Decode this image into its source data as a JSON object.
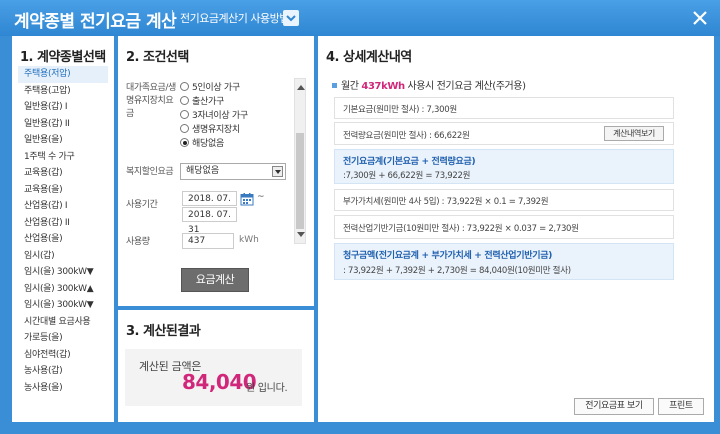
{
  "window": {
    "title": "계약종별 전기요금 계산",
    "guide_link": "전기요금계산기 사용방법"
  },
  "contract_panel": {
    "heading": "1. 계약종별선택",
    "items": [
      {
        "label": "주택용(저압)",
        "selected": true
      },
      {
        "label": "주택용(고압)"
      },
      {
        "label": "일반용(갑) I"
      },
      {
        "label": "일반용(갑) II"
      },
      {
        "label": "일반용(을)"
      },
      {
        "label": "1주택 수 가구"
      },
      {
        "label": "교육용(갑)"
      },
      {
        "label": "교육용(을)"
      },
      {
        "label": "산업용(갑) I"
      },
      {
        "label": "산업용(갑) II"
      },
      {
        "label": "산업용(을)"
      },
      {
        "label": "임시(갑)"
      },
      {
        "label": "임시(을) 300kW▼"
      },
      {
        "label": "임시(을) 300kW▲"
      },
      {
        "label": "임시(을) 300kW▼"
      },
      {
        "label": "시간대별 요금사용"
      },
      {
        "label": "가로등(을)"
      },
      {
        "label": "심야전력(갑)"
      },
      {
        "label": "농사용(갑)"
      },
      {
        "label": "농사용(을)"
      }
    ]
  },
  "condition_panel": {
    "heading": "2. 조건선택",
    "discount_label": "대가족요금/생명유지장치요금",
    "options": [
      {
        "label": "5인이상 가구",
        "checked": false
      },
      {
        "label": "출산가구",
        "checked": false
      },
      {
        "label": "3자녀이상 가구",
        "checked": false
      },
      {
        "label": "생명유지장치",
        "checked": false
      },
      {
        "label": "해당없음",
        "checked": true
      }
    ],
    "welfare_label": "복지할인요금",
    "welfare_value": "해당없음",
    "period_label": "사용기간",
    "period_start": "2018. 07. 01",
    "period_end": "2018. 07. 31",
    "period_sep": "~",
    "usage_label": "사용량",
    "usage_value": "437",
    "usage_unit": "kWh",
    "calc_button": "요금계산"
  },
  "result_panel": {
    "heading": "3. 계산된결과",
    "label": "계산된 금액은",
    "amount": "84,040",
    "suffix": "원 입니다."
  },
  "detail_panel": {
    "heading": "4. 상세계산내역",
    "summary_prefix": "월간",
    "summary_kwh": "437kWh",
    "summary_suffix": "사용시 전기요금 계산(주거용)",
    "base": "기본요금(원미만 절사) : 7,300원",
    "energy": "전력량요금(원미만 절사) : 66,622원",
    "detail_button": "계산내역보기",
    "subtotal_title": "전기요금계(기본요금 + 전력량요금)",
    "subtotal_calc": ":7,300원 + 66,622원 = 73,922원",
    "vat": "부가가치세(원미만 4사 5입) : 73,922원 × 0.1 = 7,392원",
    "fund": "전력산업기반기금(10원미만 절사) : 73,922원 × 0.037 = 2,730원",
    "total_title": "청구금액(전기요금계 + 부가가치세 + 전력산업기반기금)",
    "total_calc": ": 73,922원 + 7,392원 + 2,730원 = 84,040원(10원미만 절사)",
    "table_button": "전기요금표 보기",
    "print_button": "프린트"
  }
}
